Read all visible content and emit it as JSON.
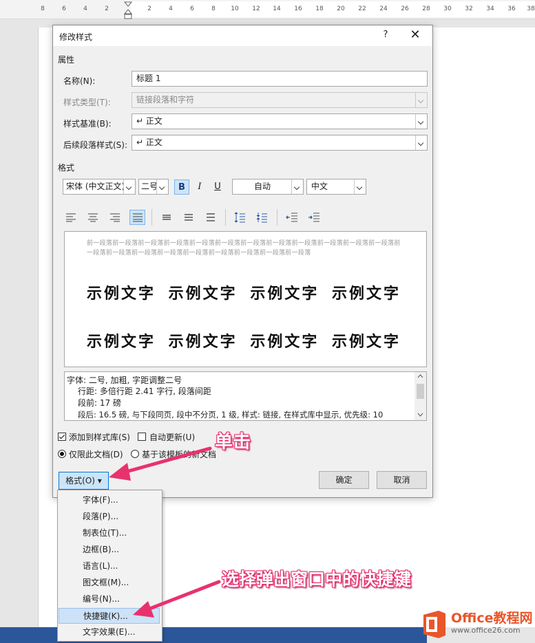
{
  "ruler": {
    "ticks": [
      "8",
      "6",
      "4",
      "2",
      "",
      "2",
      "4",
      "6",
      "8",
      "10",
      "12",
      "14",
      "16",
      "18",
      "20",
      "22",
      "24",
      "26",
      "28",
      "30",
      "32",
      "34",
      "36",
      "38"
    ]
  },
  "dialog": {
    "title": "修改样式",
    "help_label": "?",
    "close_label": "✕",
    "properties_section": "属性",
    "name_label": "名称(N):",
    "name_value": "标题 1",
    "style_type_label": "样式类型(T):",
    "style_type_value": "链接段落和字符",
    "style_based_label": "样式基准(B):",
    "style_based_value": "↵ 正文",
    "next_style_label": "后续段落样式(S):",
    "next_style_value": "↵ 正文",
    "format_section": "格式",
    "font_name": "宋体 (中文正文)",
    "font_size": "二号",
    "bold_label": "B",
    "italic_label": "I",
    "underline_label": "U",
    "color_value": "自动",
    "language_value": "中文",
    "preview_prev_text": "前一段落前一段落前一段落前一段落前一段落前一段落前一段落前一段落前一段落前一段落前一段落前一段落前一段落前一段落前一段落前一段落前一段落前一段落前一段落前一段落前一段落",
    "preview_sample_1": "示例文字 示例文字 示例文字 示例文字",
    "preview_sample_2": "示例文字 示例文字 示例文字 示例文字",
    "description": {
      "line1": "字体: 二号, 加粗, 字距调整二号",
      "line2": "行距: 多倍行距 2.41 字行, 段落间距",
      "line3": "段前: 17 磅",
      "line4": "段后: 16.5 磅, 与下段同页, 段中不分页, 1 级, 样式: 链接, 在样式库中显示, 优先级: 10"
    },
    "add_to_gallery_label": "添加到样式库(S)",
    "add_to_gallery_checked": true,
    "auto_update_label": "自动更新(U)",
    "auto_update_checked": false,
    "only_this_doc_label": "仅限此文档(D)",
    "new_docs_template_label": "基于该模板的新文档",
    "format_button_label": "格式(O) ▾",
    "ok_label": "确定",
    "cancel_label": "取消"
  },
  "menu": {
    "items": [
      {
        "label": "字体(F)..."
      },
      {
        "label": "段落(P)..."
      },
      {
        "label": "制表位(T)..."
      },
      {
        "label": "边框(B)..."
      },
      {
        "label": "语言(L)..."
      },
      {
        "label": "图文框(M)..."
      },
      {
        "label": "编号(N)..."
      },
      {
        "label": "快捷键(K)..."
      },
      {
        "label": "文字效果(E)..."
      }
    ]
  },
  "annotations": {
    "click_text": "单击",
    "select_text": "选择弹出窗口中的快捷键",
    "color": "#e8326e"
  },
  "watermark": {
    "brand": "Office教程网",
    "url": "www.office26.com"
  }
}
